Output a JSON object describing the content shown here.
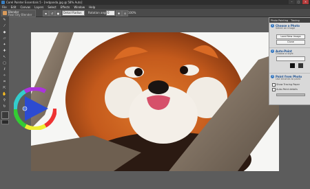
{
  "window": {
    "title": "Corel Painter Essentials 5 - [redpanda.jpg @ 58% Auto]",
    "minimize": "–",
    "maximize": "□",
    "close": "✕"
  },
  "menu": [
    "File",
    "Edit",
    "Canvas",
    "Layers",
    "Select",
    "Effects",
    "Window",
    "Help"
  ],
  "property_bar": {
    "brush_category": "Blender",
    "brush_variant": "Real Oily Blender",
    "size_value": "Detail Radius",
    "rotation_label": "Rotation angle",
    "rotation_value": "0",
    "zoom_label": "100%"
  },
  "tools": [
    "brush-tool",
    "dropper-tool",
    "paint-bucket-tool",
    "eraser-tool",
    "clone-tool",
    "rubber-stamp-tool",
    "layer-adjuster-tool",
    "rectangle-selection-tool",
    "lasso-tool",
    "magic-wand-tool",
    "crop-tool",
    "transform-tool",
    "grabber-tool",
    "magnifier-tool",
    "rotate-page-tool",
    "divine-proportion-tool"
  ],
  "tool_icons": [
    "✎",
    "⁄",
    "◆",
    "▱",
    "✦",
    "✚",
    "↖",
    "▢",
    "ℓ",
    "✧",
    "⌗",
    "⇱",
    "✋",
    "⚲",
    "↻",
    "◎"
  ],
  "photo_panel": {
    "tabs": [
      "Photo Painting",
      "Tracing"
    ],
    "step1": {
      "num": "1",
      "heading": "Choose a Photo",
      "sub": "Select an image",
      "button1": "Load New Image",
      "button2": "Clone"
    },
    "step2": {
      "num": "2",
      "heading": "Auto-Paint",
      "sub": "Choose a style"
    },
    "step3": {
      "num": "3",
      "heading": "Paint from Photo",
      "sub": "Use brushes to paint",
      "check1": "Show Tracing Paper",
      "check2": "Auto-Paint details"
    }
  },
  "colors": {
    "panel_accent": "#2f74c0",
    "selected_color": "#3a4fbf"
  }
}
